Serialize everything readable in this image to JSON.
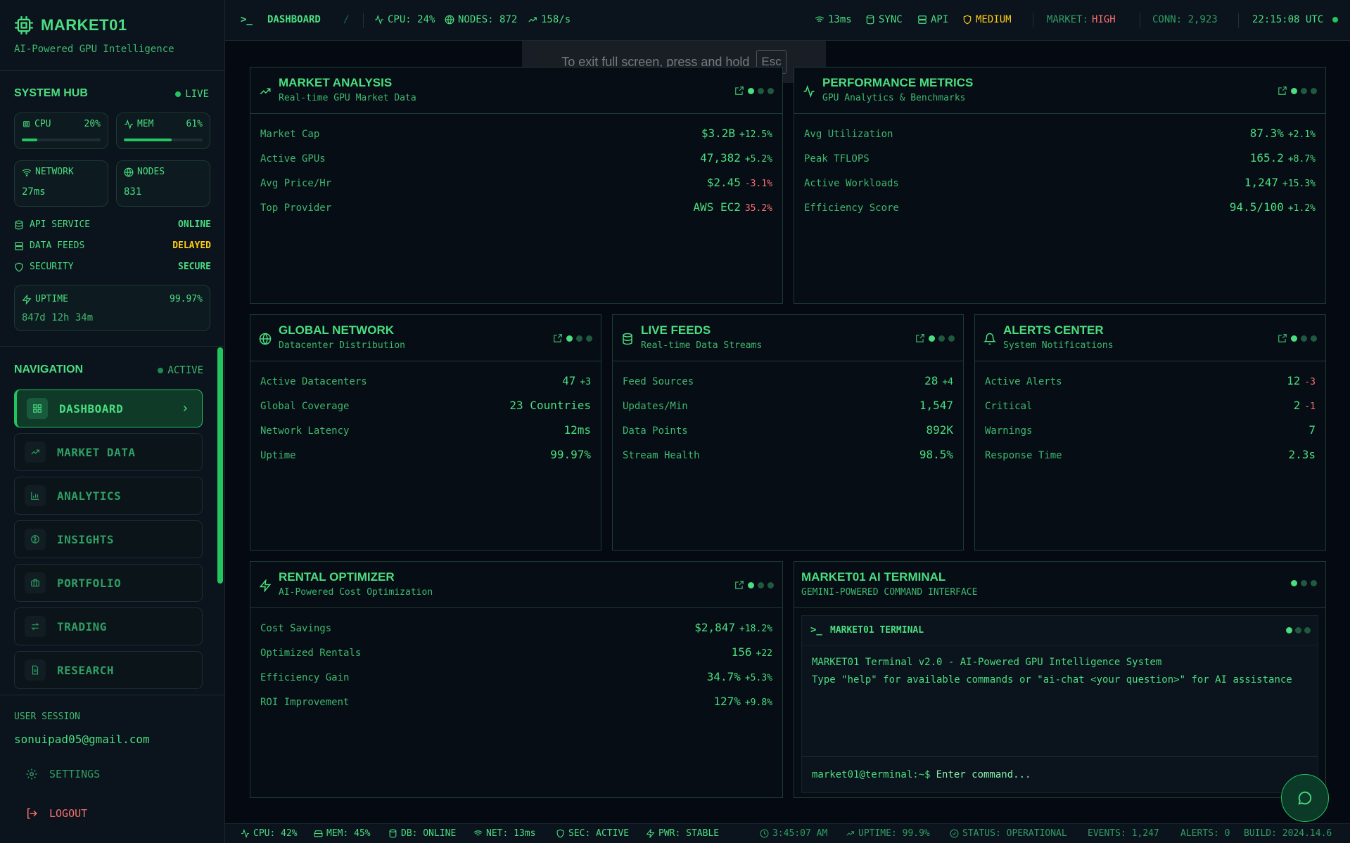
{
  "brand": {
    "title": "MARKET01",
    "subtitle": "AI-Powered GPU Intelligence"
  },
  "system_hub": {
    "title": "SYSTEM HUB",
    "live": "LIVE",
    "cpu": {
      "label": "CPU",
      "pct": "20%",
      "level": 0.2
    },
    "mem": {
      "label": "MEM",
      "pct": "61%",
      "level": 0.61
    },
    "network": {
      "label": "NETWORK",
      "value": "27ms"
    },
    "nodes": {
      "label": "NODES",
      "value": "831"
    },
    "services": [
      {
        "label": "API SERVICE",
        "status": "ONLINE",
        "color": "#4ade80"
      },
      {
        "label": "DATA FEEDS",
        "status": "DELAYED",
        "color": "#facc15"
      },
      {
        "label": "SECURITY",
        "status": "SECURE",
        "color": "#4ade80"
      }
    ],
    "uptime": {
      "label": "UPTIME",
      "pct": "99.97%",
      "duration": "847d 12h 34m"
    }
  },
  "navigation": {
    "title": "NAVIGATION",
    "status": "ACTIVE",
    "items": [
      {
        "label": "DASHBOARD",
        "icon": "grid-icon",
        "active": true
      },
      {
        "label": "MARKET DATA",
        "icon": "trending-up-icon"
      },
      {
        "label": "ANALYTICS",
        "icon": "bar-chart-icon"
      },
      {
        "label": "INSIGHTS",
        "icon": "brain-icon"
      },
      {
        "label": "PORTFOLIO",
        "icon": "briefcase-icon"
      },
      {
        "label": "TRADING",
        "icon": "swap-icon"
      },
      {
        "label": "RESEARCH",
        "icon": "document-icon"
      }
    ]
  },
  "session": {
    "label": "USER SESSION",
    "email": "sonuipad05@gmail.com",
    "settings": "SETTINGS",
    "logout": "LOGOUT"
  },
  "topbar": {
    "prompt": ">_",
    "page": "DASHBOARD",
    "sep": "/",
    "cpu": "CPU: 24%",
    "nodes": "NODES: 872",
    "rate": "158/s",
    "latency": "13ms",
    "sync": "SYNC",
    "api": "API",
    "risk": "MEDIUM",
    "market_label": "MARKET:",
    "market_value": "HIGH",
    "conn": "CONN: 2,923",
    "clock": "22:15:08 UTC"
  },
  "fullscreen_toast": {
    "text": "To exit full screen, press and hold",
    "key": "Esc"
  },
  "panels": {
    "market": {
      "title": "MARKET ANALYSIS",
      "subtitle": "Real-time GPU Market Data",
      "rows": [
        {
          "k": "Market Cap",
          "v": "$3.2B",
          "c": "+12.5%",
          "dir": "up"
        },
        {
          "k": "Active GPUs",
          "v": "47,382",
          "c": "+5.2%",
          "dir": "up"
        },
        {
          "k": "Avg Price/Hr",
          "v": "$2.45",
          "c": "-3.1%",
          "dir": "down"
        },
        {
          "k": "Top Provider",
          "v": "AWS EC2",
          "c": "35.2%",
          "dir": "down"
        }
      ]
    },
    "performance": {
      "title": "PERFORMANCE METRICS",
      "subtitle": "GPU Analytics & Benchmarks",
      "rows": [
        {
          "k": "Avg Utilization",
          "v": "87.3%",
          "c": "+2.1%",
          "dir": "up"
        },
        {
          "k": "Peak TFLOPS",
          "v": "165.2",
          "c": "+8.7%",
          "dir": "up"
        },
        {
          "k": "Active Workloads",
          "v": "1,247",
          "c": "+15.3%",
          "dir": "up"
        },
        {
          "k": "Efficiency Score",
          "v": "94.5/100",
          "c": "+1.2%",
          "dir": "up"
        }
      ]
    },
    "network": {
      "title": "GLOBAL NETWORK",
      "subtitle": "Datacenter Distribution",
      "rows": [
        {
          "k": "Active Datacenters",
          "v": "47",
          "c": "+3",
          "dir": "up"
        },
        {
          "k": "Global Coverage",
          "v": "23 Countries",
          "c": "",
          "dir": "up"
        },
        {
          "k": "Network Latency",
          "v": "12ms",
          "c": "",
          "dir": "up"
        },
        {
          "k": "Uptime",
          "v": "99.97%",
          "c": "",
          "dir": "up"
        }
      ]
    },
    "feeds": {
      "title": "LIVE FEEDS",
      "subtitle": "Real-time Data Streams",
      "rows": [
        {
          "k": "Feed Sources",
          "v": "28",
          "c": "+4",
          "dir": "up"
        },
        {
          "k": "Updates/Min",
          "v": "1,547",
          "c": "",
          "dir": "up"
        },
        {
          "k": "Data Points",
          "v": "892K",
          "c": "",
          "dir": "up"
        },
        {
          "k": "Stream Health",
          "v": "98.5%",
          "c": "",
          "dir": "up"
        }
      ]
    },
    "alerts": {
      "title": "ALERTS CENTER",
      "subtitle": "System Notifications",
      "rows": [
        {
          "k": "Active Alerts",
          "v": "12",
          "c": "-3",
          "dir": "down"
        },
        {
          "k": "Critical",
          "v": "2",
          "c": "-1",
          "dir": "down"
        },
        {
          "k": "Warnings",
          "v": "7",
          "c": "",
          "dir": "up"
        },
        {
          "k": "Response Time",
          "v": "2.3s",
          "c": "",
          "dir": "up"
        }
      ]
    },
    "rental": {
      "title": "RENTAL OPTIMIZER",
      "subtitle": "AI-Powered Cost Optimization",
      "rows": [
        {
          "k": "Cost Savings",
          "v": "$2,847",
          "c": "+18.2%",
          "dir": "up"
        },
        {
          "k": "Optimized Rentals",
          "v": "156",
          "c": "+22",
          "dir": "up"
        },
        {
          "k": "Efficiency Gain",
          "v": "34.7%",
          "c": "+5.3%",
          "dir": "up"
        },
        {
          "k": "ROI Improvement",
          "v": "127%",
          "c": "+9.8%",
          "dir": "up"
        }
      ]
    },
    "terminal": {
      "title": "MARKET01 AI TERMINAL",
      "subtitle": "GEMINI-POWERED COMMAND INTERFACE",
      "head": "MARKET01 TERMINAL",
      "lines": [
        "MARKET01 Terminal v2.0 - AI-Powered GPU Intelligence System",
        "Type \"help\" for available commands or \"ai-chat <your question>\" for AI assistance"
      ],
      "prompt": "market01@terminal:~$",
      "placeholder": "Enter command..."
    }
  },
  "footer": {
    "cpu": "CPU: 42%",
    "mem": "MEM: 45%",
    "db": "DB: ONLINE",
    "net": "NET: 13ms",
    "sec": "SEC: ACTIVE",
    "pwr": "PWR: STABLE",
    "time": "3:45:07 AM",
    "uptime": "UPTIME: 99.9%",
    "status": "STATUS: OPERATIONAL",
    "events": "EVENTS: 1,247",
    "alerts": "ALERTS: 0",
    "build": "BUILD: 2024.14.6"
  },
  "colors": {
    "accent": "#4ade80",
    "danger": "#f87171",
    "warning": "#facc15",
    "background": "#050a12"
  }
}
